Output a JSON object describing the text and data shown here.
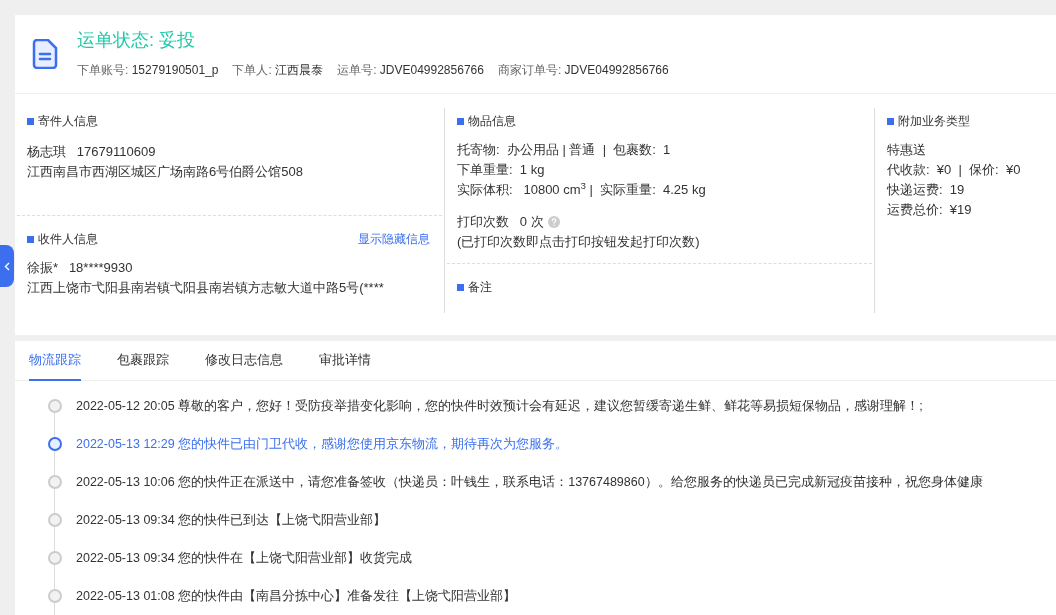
{
  "header": {
    "status": "运单状态: 妥投",
    "fields": [
      {
        "label": "下单账号:",
        "value": "15279190501_p"
      },
      {
        "label": "下单人:",
        "value": "江西晨泰"
      },
      {
        "label": "运单号:",
        "value": "JDVE04992856766"
      },
      {
        "label": "商家订单号:",
        "value": "JDVE04992856766"
      }
    ]
  },
  "sender": {
    "title": "寄件人信息",
    "name": "杨志琪",
    "phone": "17679110609",
    "address": "江西南昌市西湖区城区广场南路6号伯爵公馆508"
  },
  "receiver": {
    "title": "收件人信息",
    "link": "显示隐藏信息",
    "name": "徐振*",
    "phone": "18****9930",
    "address": "江西上饶市弋阳县南岩镇弋阳县南岩镇方志敏大道中路5号(****"
  },
  "goods": {
    "title": "物品信息",
    "lines": [
      "托寄物:  办公用品 | 普通  |  包裹数:  1",
      "下单重量:  1 kg",
      "实际体积:   10800 cm$^{3}$ |  实际重量:  4.25 kg"
    ],
    "print_count": "打印次数   0 次",
    "print_note": "(已打印次数即点击打印按钮发起打印次数)"
  },
  "remarks": {
    "title": "备注"
  },
  "extra": {
    "title": "附加业务类型",
    "lines": [
      "特惠送",
      "代收款:  ¥0  |  保价:  ¥0",
      "快递运费:  19",
      "运费总价:  ¥19"
    ]
  },
  "tabs": [
    {
      "label": "物流跟踪",
      "selected": true
    },
    {
      "label": "包裹跟踪",
      "selected": false
    },
    {
      "label": "修改日志信息",
      "selected": false
    },
    {
      "label": "审批详情",
      "selected": false
    }
  ],
  "tracking": [
    {
      "time": "2022-05-12 20:05",
      "text": "尊敬的客户，您好！受防疫举措变化影响，您的快件时效预计会有延迟，建议您暂缓寄递生鲜、鲜花等易损短保物品，感谢理解！;",
      "selected": false
    },
    {
      "time": "2022-05-13 12:29",
      "text": "您的快件已由门卫代收，感谢您使用京东物流，期待再次为您服务。",
      "selected": true
    },
    {
      "time": "2022-05-13 10:06",
      "text": "您的快件正在派送中，请您准备签收（快递员：叶钱生，联系电话：13767489860）。给您服务的快递员已完成新冠疫苗接种，祝您身体健康",
      "selected": false
    },
    {
      "time": "2022-05-13 09:34",
      "text": "您的快件已到达【上饶弋阳营业部】",
      "selected": false
    },
    {
      "time": "2022-05-13 09:34",
      "text": "您的快件在【上饶弋阳营业部】收货完成",
      "selected": false
    },
    {
      "time": "2022-05-13 01:08",
      "text": "您的快件由【南昌分拣中心】准备发往【上饶弋阳营业部】",
      "selected": false
    }
  ]
}
